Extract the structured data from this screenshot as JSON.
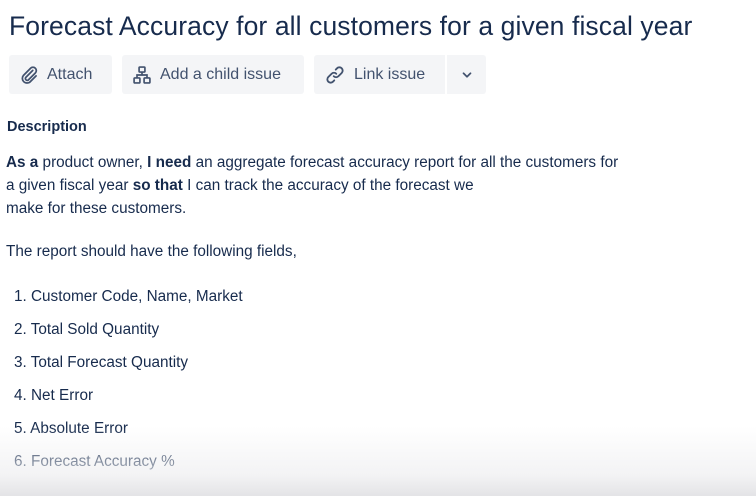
{
  "issue": {
    "title": "Forecast Accuracy for all customers for a given fiscal year"
  },
  "toolbar": {
    "attach_label": "Attach",
    "attach_icon": "paperclip-icon",
    "child_label": "Add a child issue",
    "child_icon": "hierarchy-icon",
    "link_label": "Link issue",
    "link_icon": "link-icon",
    "more_icon": "chevron-down-icon"
  },
  "description": {
    "label": "Description",
    "story": {
      "as_a": "As a",
      "role": " product owner, ",
      "i_need": "I need",
      "need": " an aggregate forecast accuracy report for all the customers for",
      "need_cont": "a given fiscal year ",
      "so_that": "so that",
      "goal": " I can track the accuracy of the forecast we",
      "goal_cont": "make for these customers."
    },
    "fields_intro": "The report should have the following fields,",
    "fields": [
      "1. Customer Code, Name, Market",
      "2. Total Sold Quantity",
      "3. Total Forecast Quantity",
      "4. Net Error",
      "5. Absolute Error",
      "6. Forecast Accuracy %"
    ]
  },
  "colors": {
    "text": "#172b4d",
    "button_bg": "#f4f5f7",
    "button_text": "#42526e"
  }
}
